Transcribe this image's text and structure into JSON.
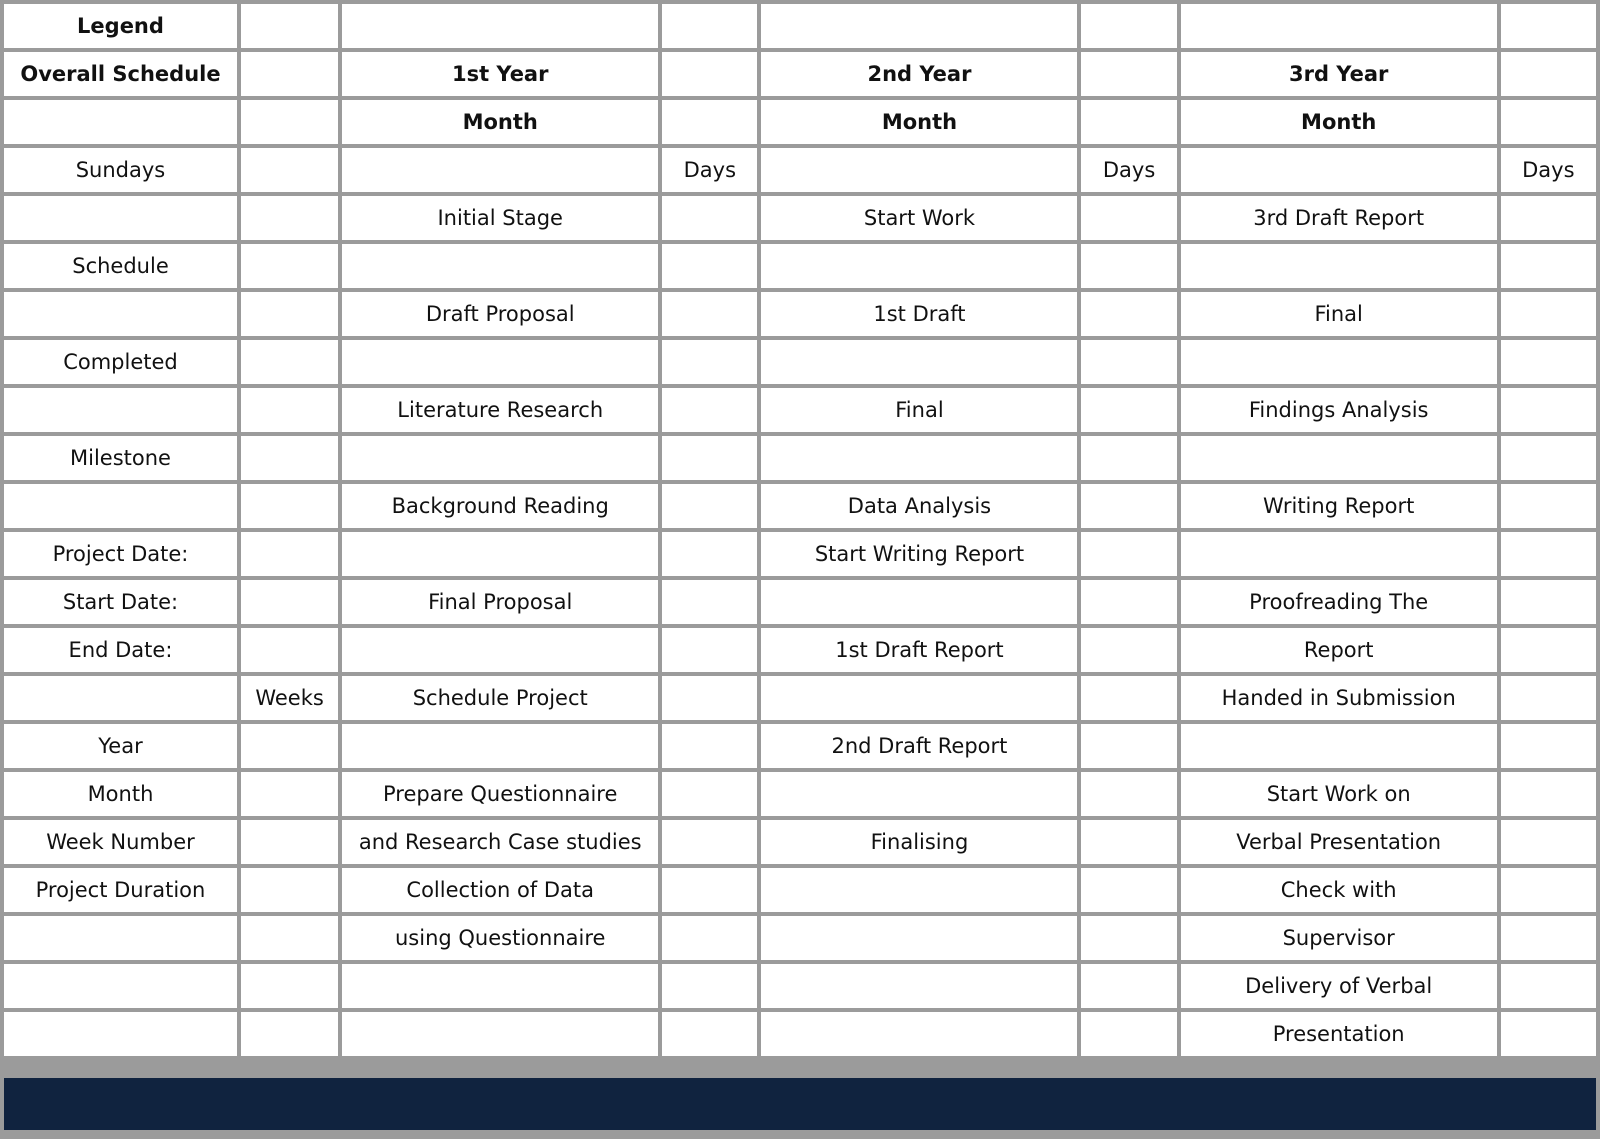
{
  "sheet": {
    "legend_title": "Legend",
    "colors": {
      "navy": "#10233f",
      "band": "#b6bfcb",
      "label": "#cdd3db",
      "label_light": "#e4e7ea",
      "grid_line": "#9b9b9b",
      "cell": "#ffffff"
    }
  },
  "headers": {
    "overall_schedule": "Overall Schedule",
    "year1": "1st Year",
    "year2": "2nd Year",
    "year3": "3rd Year",
    "month": "Month",
    "days": "Days",
    "weeks": "Weeks"
  },
  "legend_items": [
    {
      "label": "Sundays",
      "style": "label"
    },
    {
      "label": "Schedule",
      "style": "label"
    },
    {
      "label": "Completed",
      "style": "label"
    },
    {
      "label": "Milestone",
      "style": "label-light"
    },
    {
      "label": "Project Date:",
      "style": "label"
    },
    {
      "label": "Start Date:",
      "style": "label"
    },
    {
      "label": "End Date:",
      "style": "label"
    },
    {
      "label": "Year",
      "style": "label"
    },
    {
      "label": "Month",
      "style": "label"
    },
    {
      "label": "Week Number",
      "style": "label"
    },
    {
      "label": "Project Duration",
      "style": "label"
    }
  ],
  "rows": [
    {
      "legend": "Legend",
      "gap": "",
      "y1": "",
      "d1": "",
      "y2": "",
      "d2": "",
      "y3": "",
      "d3": ""
    },
    {
      "legend": "Overall Schedule",
      "gap": "",
      "y1": "1st Year",
      "d1": "",
      "y2": "2nd Year",
      "d2": "",
      "y3": "3rd Year",
      "d3": ""
    },
    {
      "legend": "",
      "gap": "",
      "y1": "Month",
      "d1": "",
      "y2": "Month",
      "d2": "",
      "y3": "Month",
      "d3": ""
    },
    {
      "legend": "Sundays",
      "gap": "",
      "y1": "",
      "d1": "Days",
      "y2": "",
      "d2": "Days",
      "y3": "",
      "d3": "Days"
    },
    {
      "legend": "",
      "gap": "",
      "y1": "Initial Stage",
      "d1": "",
      "y2": "Start Work",
      "d2": "",
      "y3": "3rd Draft Report",
      "d3": ""
    },
    {
      "legend": "Schedule",
      "gap": "",
      "y1": "",
      "d1": "",
      "y2": "",
      "d2": "",
      "y3": "",
      "d3": ""
    },
    {
      "legend": "",
      "gap": "",
      "y1": "Draft Proposal",
      "d1": "",
      "y2": "1st Draft",
      "d2": "",
      "y3": "Final",
      "d3": ""
    },
    {
      "legend": "Completed",
      "gap": "",
      "y1": "",
      "d1": "",
      "y2": "",
      "d2": "",
      "y3": "",
      "d3": ""
    },
    {
      "legend": "",
      "gap": "",
      "y1": "Literature Research",
      "d1": "",
      "y2": "Final",
      "d2": "",
      "y3": "Findings Analysis",
      "d3": ""
    },
    {
      "legend": "Milestone",
      "gap": "",
      "y1": "",
      "d1": "",
      "y2": "",
      "d2": "",
      "y3": "",
      "d3": ""
    },
    {
      "legend": "",
      "gap": "",
      "y1": "Background Reading",
      "d1": "",
      "y2": "Data Analysis",
      "d2": "",
      "y3": "Writing Report",
      "d3": ""
    },
    {
      "legend": "Project Date:",
      "gap": "",
      "y1": "",
      "d1": "",
      "y2": "Start Writing Report",
      "d2": "",
      "y3": "",
      "d3": ""
    },
    {
      "legend": "Start Date:",
      "gap": "",
      "y1": "Final Proposal",
      "d1": "",
      "y2": "",
      "d2": "",
      "y3": "Proofreading The",
      "d3": ""
    },
    {
      "legend": "End Date:",
      "gap": "",
      "y1": "",
      "d1": "",
      "y2": "1st Draft Report",
      "d2": "",
      "y3": "Report",
      "d3": ""
    },
    {
      "legend": "",
      "gap": "Weeks",
      "y1": "Schedule Project",
      "d1": "",
      "y2": "",
      "d2": "",
      "y3": "Handed in Submission",
      "d3": ""
    },
    {
      "legend": "Year",
      "gap": "",
      "y1": "",
      "d1": "",
      "y2": "2nd Draft Report",
      "d2": "",
      "y3": "",
      "d3": ""
    },
    {
      "legend": "Month",
      "gap": "",
      "y1": "Prepare Questionnaire",
      "d1": "",
      "y2": "",
      "d2": "",
      "y3": "Start Work on",
      "d3": ""
    },
    {
      "legend": "Week Number",
      "gap": "",
      "y1": "and Research Case studies",
      "d1": "",
      "y2": "Finalising",
      "d2": "",
      "y3": "Verbal Presentation",
      "d3": ""
    },
    {
      "legend": "Project Duration",
      "gap": "",
      "y1": "Collection of Data",
      "d1": "",
      "y2": "",
      "d2": "",
      "y3": "Check with",
      "d3": ""
    },
    {
      "legend": "",
      "gap": "",
      "y1": "using Questionnaire",
      "d1": "",
      "y2": "",
      "d2": "",
      "y3": "Supervisor",
      "d3": ""
    },
    {
      "legend": "",
      "gap": "",
      "y1": "",
      "d1": "",
      "y2": "",
      "d2": "",
      "y3": "Delivery of Verbal",
      "d3": ""
    },
    {
      "legend": "",
      "gap": "",
      "y1": "",
      "d1": "",
      "y2": "",
      "d2": "",
      "y3": "Presentation",
      "d3": ""
    }
  ]
}
